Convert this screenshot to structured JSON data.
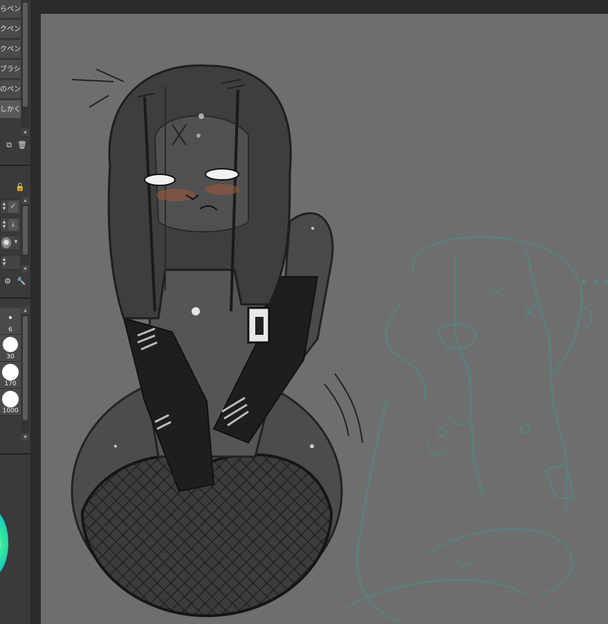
{
  "subtool_panel": {
    "items": [
      {
        "label": "らペン",
        "active": false
      },
      {
        "label": "クペン",
        "active": false
      },
      {
        "label": "クペン",
        "active": false
      },
      {
        "label": "ブラシ",
        "active": false
      },
      {
        "label": "のペン",
        "active": false
      },
      {
        "label": "しかく",
        "active": true
      }
    ],
    "icons": [
      "copy-subtool-icon",
      "delete-subtool-icon"
    ]
  },
  "tool_property": {
    "icons": [
      "lock-icon",
      "stabilization-icon",
      "download-icon",
      "anti-alias-icon",
      "settings-icon",
      "wrench-icon"
    ]
  },
  "brush_size": {
    "sizes": [
      {
        "label": "6"
      },
      {
        "label": "30"
      },
      {
        "label": "170"
      },
      {
        "label": "1000"
      }
    ]
  },
  "colors": {
    "panel_bg": "#3a3a3a",
    "canvas_bg": "#6e6e6e",
    "app_bg": "#2b2b2b",
    "sketch_line": "#4f8a86",
    "wheel_accent": "#36e89a"
  }
}
